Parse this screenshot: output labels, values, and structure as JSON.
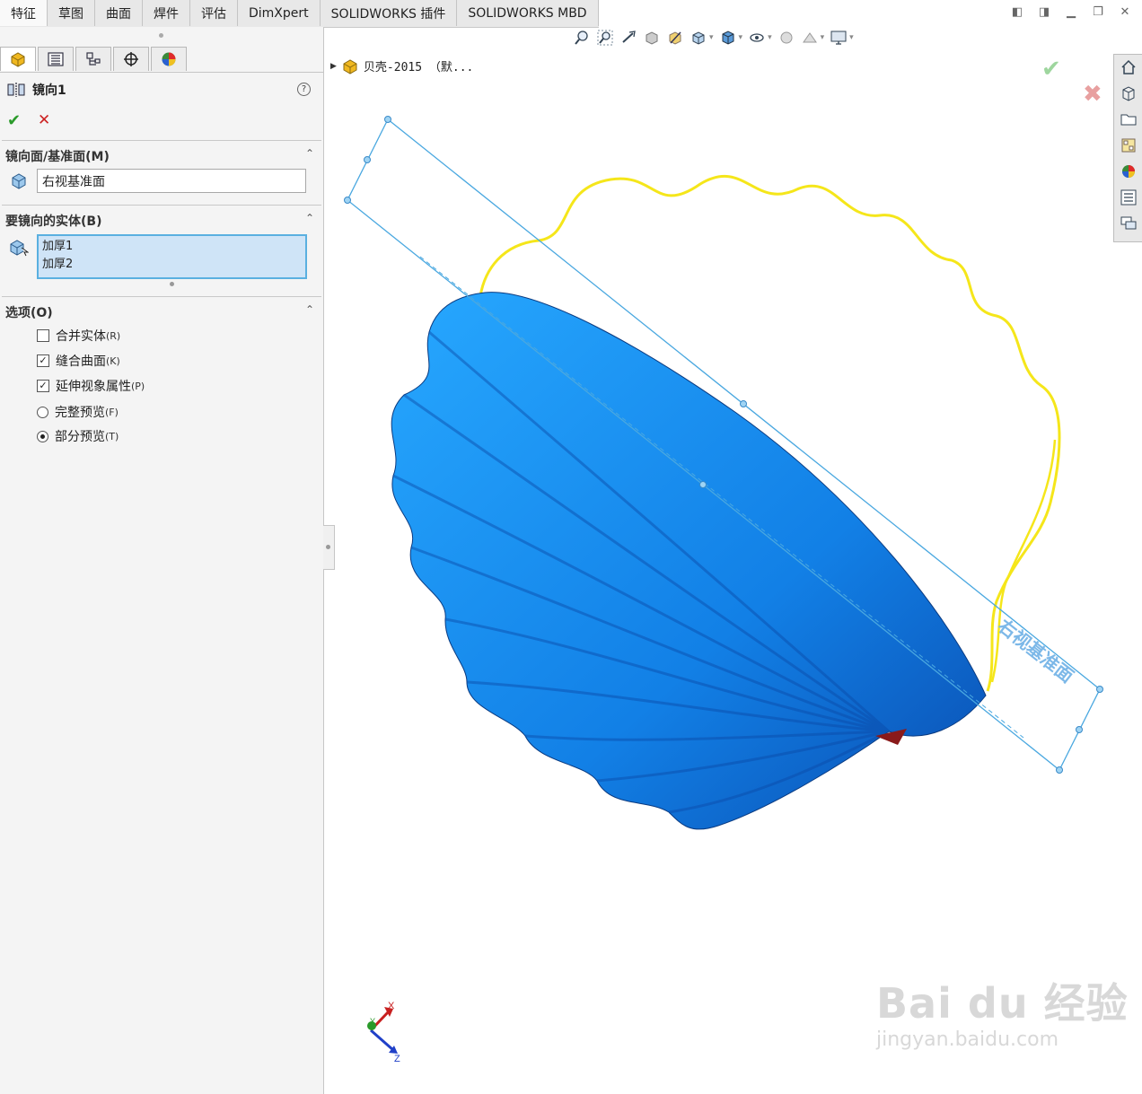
{
  "tabs": [
    "特征",
    "草图",
    "曲面",
    "焊件",
    "评估",
    "DimXpert",
    "SOLIDWORKS 插件",
    "SOLIDWORKS MBD"
  ],
  "property_manager": {
    "title": "镜向1",
    "mirror_face_group": {
      "heading": "镜向面/基准面(M)",
      "value": "右视基准面"
    },
    "bodies_group": {
      "heading": "要镜向的实体(B)",
      "items": [
        "加厚1",
        "加厚2"
      ]
    },
    "options_group": {
      "heading": "选项(O)",
      "merge_solids": {
        "label": "合并实体",
        "hotkey": "(R)",
        "checked": false
      },
      "knit_surfaces": {
        "label": "缝合曲面",
        "hotkey": "(K)",
        "checked": true
      },
      "propagate_visual": {
        "label": "延伸视象属性",
        "hotkey": "(P)",
        "checked": true
      },
      "full_preview": {
        "label": "完整预览",
        "hotkey": "(F)",
        "selected": false
      },
      "partial_preview": {
        "label": "部分预览",
        "hotkey": "(T)",
        "selected": true
      }
    }
  },
  "feature_tree": {
    "root_label": "贝壳-2015 （默..."
  },
  "viewport": {
    "plane_label": "右视基准面",
    "triad": {
      "x": "X",
      "y": "Y",
      "z": "Z"
    }
  },
  "watermark": {
    "main": "Bai du 经验",
    "sub": "jingyan.baidu.com"
  },
  "colors": {
    "shell_blue": "#1a8ff0",
    "plane_blue": "#4aa8e0",
    "sketch_yellow": "#f5e61a",
    "accept_green": "#2a9a2a",
    "cancel_red": "#cc2222"
  }
}
